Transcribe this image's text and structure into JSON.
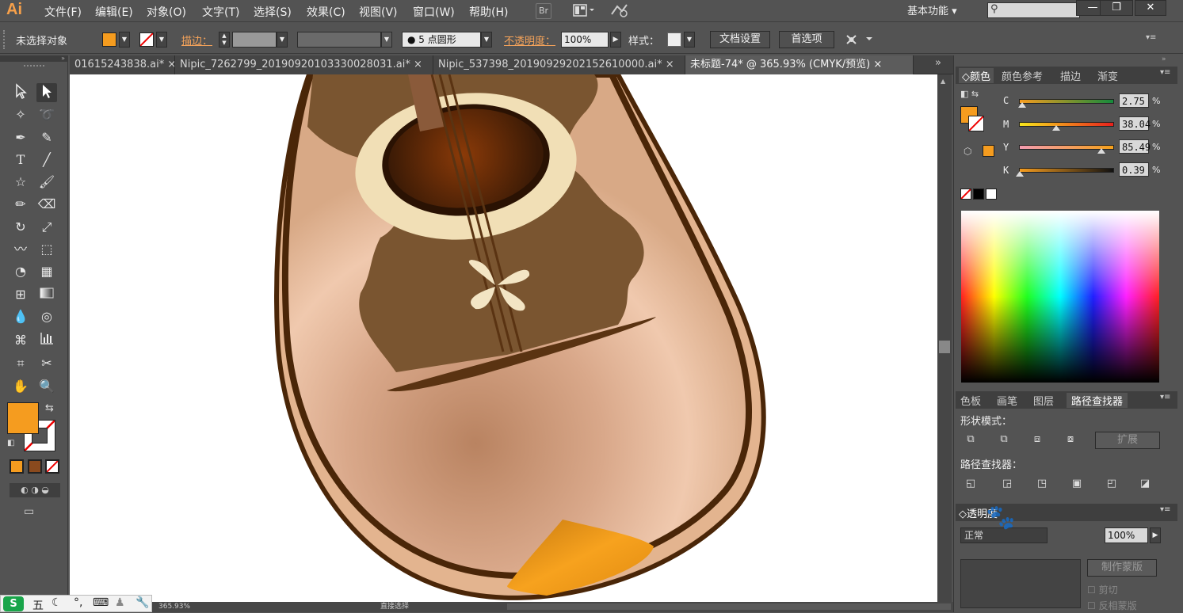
{
  "app": {
    "logo": "Ai",
    "menus": [
      "文件(F)",
      "编辑(E)",
      "对象(O)",
      "文字(T)",
      "选择(S)",
      "效果(C)",
      "视图(V)",
      "窗口(W)",
      "帮助(H)"
    ],
    "br_label": "Br",
    "workspace": "基本功能",
    "workspace_arrow": "▾",
    "window_buttons": [
      "—",
      "❐",
      "✕"
    ]
  },
  "control_bar": {
    "selection_status": "未选择对象",
    "stroke_label": "描边：",
    "stroke_profile": "5 点圆形",
    "opacity_label": "不透明度：",
    "opacity_value": "100%",
    "style_label": "样式：",
    "doc_setup_button": "文档设置",
    "preferences_button": "首选项",
    "fill_color": "#f59c1f"
  },
  "tabs": [
    {
      "label": "01615243838.ai*",
      "close": "×"
    },
    {
      "label": "Nipic_7262799_20190920103330028031.ai*",
      "close": "×"
    },
    {
      "label": "Nipic_537398_20190929202152610000.ai*",
      "close": "×"
    },
    {
      "label": "未标题-74* @ 365.93% (CMYK/预览)",
      "close": "×"
    }
  ],
  "tabs_overflow": "»",
  "color_panel": {
    "tabs": [
      "颜色",
      "颜色参考",
      "描边",
      "渐变"
    ],
    "channels": [
      {
        "name": "C",
        "value": "2.75",
        "unit": "%",
        "level": 0.0275
      },
      {
        "name": "M",
        "value": "38.04",
        "unit": "%",
        "level": 0.3804
      },
      {
        "name": "Y",
        "value": "85.49",
        "unit": "%",
        "level": 0.8549
      },
      {
        "name": "K",
        "value": "0.39",
        "unit": "%",
        "level": 0.0039
      }
    ],
    "fill_color": "#f59c1f"
  },
  "pathfinder_panel": {
    "tabs": [
      "色板",
      "画笔",
      "图层",
      "路径查找器"
    ],
    "shape_modes_label": "形状模式：",
    "expand_button": "扩展",
    "pathfinders_label": "路径查找器："
  },
  "transparency_panel": {
    "title": "透明度",
    "mode": "正常",
    "opacity": "100%",
    "make_mask_button": "制作蒙版",
    "clip_label": "剪切",
    "invert_mask_label": "反相蒙版"
  },
  "status_bar": {
    "zoom": "365.93%",
    "tool_name": "直接选择"
  },
  "taskbar": {
    "ime_label": "五"
  }
}
